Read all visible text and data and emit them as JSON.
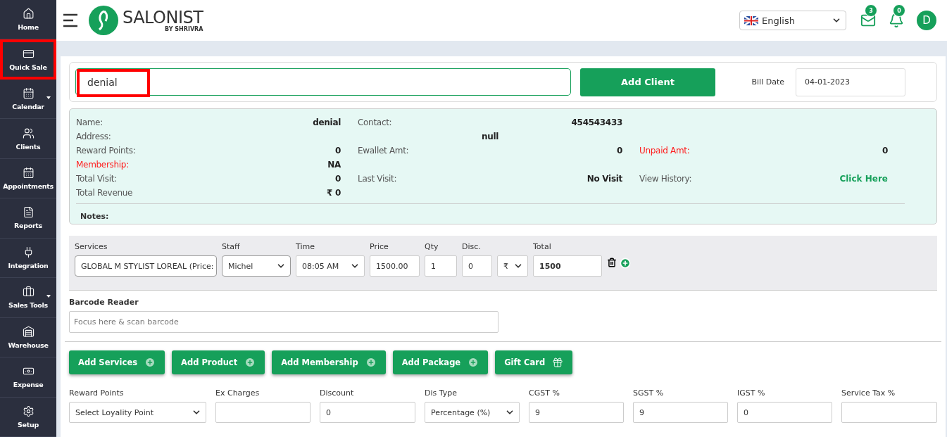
{
  "sidebar": {
    "items": [
      {
        "label": "Home",
        "highlighted": false,
        "has_submenu": false
      },
      {
        "label": "Quick Sale",
        "highlighted": true,
        "has_submenu": false
      },
      {
        "label": "Calendar",
        "highlighted": false,
        "has_submenu": true
      },
      {
        "label": "Clients",
        "highlighted": false,
        "has_submenu": false
      },
      {
        "label": "Appointments",
        "highlighted": false,
        "has_submenu": false
      },
      {
        "label": "Reports",
        "highlighted": false,
        "has_submenu": false
      },
      {
        "label": "Integration",
        "highlighted": false,
        "has_submenu": false
      },
      {
        "label": "Sales Tools",
        "highlighted": false,
        "has_submenu": true
      },
      {
        "label": "Warehouse",
        "highlighted": false,
        "has_submenu": false
      },
      {
        "label": "Expense",
        "highlighted": false,
        "has_submenu": false
      },
      {
        "label": "Setup",
        "highlighted": false,
        "has_submenu": false
      }
    ]
  },
  "header": {
    "logo": {
      "name": "SALONIST",
      "tagline": "BY SHRIVRA"
    },
    "language": "English",
    "messages_count": "3",
    "notifications_count": "0",
    "avatar": "D"
  },
  "client_bar": {
    "search": {
      "value": "denial",
      "highlighted": true
    },
    "add_button": "Add Client",
    "bill_date_label": "Bill Date",
    "bill_date": "04-01-2023"
  },
  "client_info": {
    "rows": [
      [
        {
          "kind": "pair",
          "label": "Name:",
          "value": "denial"
        },
        {
          "kind": "pair",
          "label": "Contact:",
          "value": "454543433"
        },
        {
          "kind": "empty"
        }
      ],
      [
        {
          "kind": "pair",
          "label": "Address:"
        },
        {
          "kind": "center",
          "value": "null"
        },
        {
          "kind": "empty"
        }
      ],
      [
        {
          "kind": "pair",
          "label": "Reward Points:",
          "value": "0"
        },
        {
          "kind": "pair",
          "label": "Ewallet Amt:",
          "value": "0"
        },
        {
          "kind": "alert_pair",
          "label": "Unpaid Amt:",
          "value": "0"
        }
      ],
      [
        {
          "kind": "alert_pair",
          "label": "Membership:",
          "value": "NA"
        },
        {
          "kind": "empty"
        },
        {
          "kind": "empty"
        }
      ],
      [
        {
          "kind": "pair",
          "label": "Total Visit:",
          "value": "0"
        },
        {
          "kind": "pair",
          "label": "Last Visit:",
          "value": "No Visit"
        },
        {
          "kind": "link_pair",
          "label": "View History:",
          "value": "Click Here"
        }
      ],
      [
        {
          "kind": "pair",
          "label": "Total Revenue",
          "value": "₹ 0"
        },
        {
          "kind": "empty"
        },
        {
          "kind": "empty"
        }
      ]
    ],
    "notes_label": "Notes:"
  },
  "service_line": {
    "fields": [
      {
        "kind": "select",
        "label": "Services",
        "value": "GLOBAL M STYLIST LOREAL (Price:"
      },
      {
        "kind": "select",
        "label": "Staff",
        "value": "Michel"
      },
      {
        "kind": "select",
        "label": "Time",
        "value": "08:05 AM"
      },
      {
        "kind": "input",
        "label": "Price",
        "value": "1500.00"
      },
      {
        "kind": "input",
        "label": "Qty",
        "value": "1"
      },
      {
        "kind": "input",
        "label": "Disc.",
        "value": "0"
      },
      {
        "kind": "select",
        "value": "₹"
      },
      {
        "kind": "total",
        "label": "Total",
        "value": "1500"
      }
    ]
  },
  "barcode": {
    "label": "Barcode Reader",
    "placeholder": "Focus here & scan barcode"
  },
  "actions": [
    {
      "label": "Add Services",
      "kind": "plus"
    },
    {
      "label": "Add Product",
      "kind": "plus"
    },
    {
      "label": "Add Membership",
      "kind": "plus"
    },
    {
      "label": "Add Package",
      "kind": "plus"
    },
    {
      "label": "Gift Card",
      "kind": "card"
    }
  ],
  "charges": [
    {
      "kind": "select",
      "label": "Reward Points",
      "value": "Select Loyality Point"
    },
    {
      "kind": "input",
      "label": "Ex Charges"
    },
    {
      "kind": "input",
      "label": "Discount",
      "value": "0"
    },
    {
      "kind": "select",
      "label": "Dis Type",
      "value": "Percentage (%)"
    },
    {
      "kind": "input",
      "label": "CGST %",
      "value": "9"
    },
    {
      "kind": "input",
      "label": "SGST %",
      "value": "9"
    },
    {
      "kind": "input",
      "label": "IGST %",
      "value": "0"
    },
    {
      "kind": "input",
      "label": "Service Tax %"
    }
  ]
}
